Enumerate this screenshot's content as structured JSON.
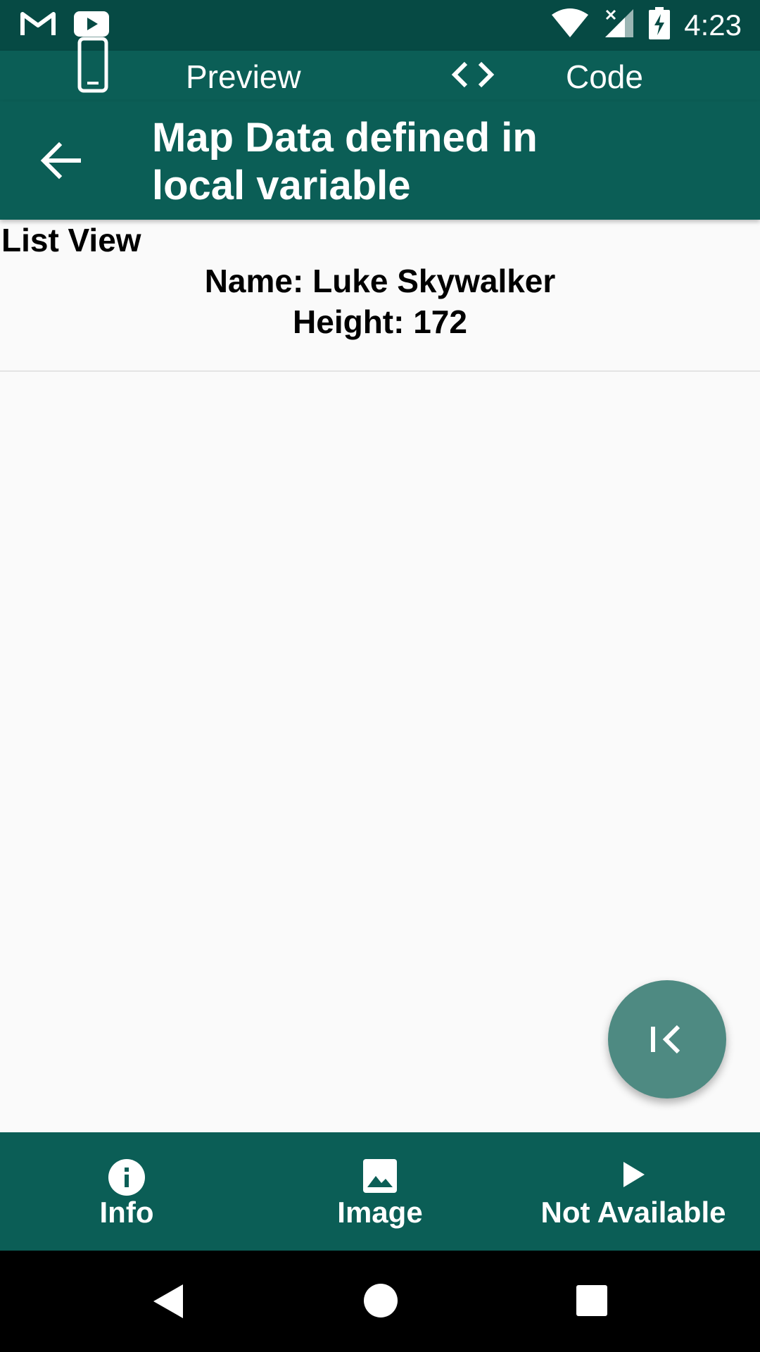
{
  "status_bar": {
    "time": "4:23",
    "icons": [
      "gmail-icon",
      "youtube-icon",
      "wifi-icon",
      "signal-icon",
      "battery-charging-icon"
    ]
  },
  "top_tabs": {
    "preview_label": "Preview",
    "code_label": "Code",
    "icons": [
      "phone-icon",
      "code-icon"
    ]
  },
  "appbar": {
    "title_line1": "Map Data defined in",
    "title_line2": "local variable",
    "back_icon": "arrow-back-icon"
  },
  "content": {
    "list_title": "List View",
    "items": [
      {
        "name": "Name: Luke Skywalker",
        "height": "Height: 172"
      }
    ]
  },
  "fab": {
    "icon": "first-page-icon"
  },
  "bottom_nav": {
    "items": [
      {
        "label": "Info",
        "icon": "info-icon"
      },
      {
        "label": "Image",
        "icon": "image-icon"
      },
      {
        "label": "Not Available",
        "icon": "play-icon"
      }
    ]
  },
  "colors": {
    "primary": "#0b5e56",
    "status_bar": "#064a44",
    "fab": "#4e8a82",
    "background": "#fafafa"
  }
}
